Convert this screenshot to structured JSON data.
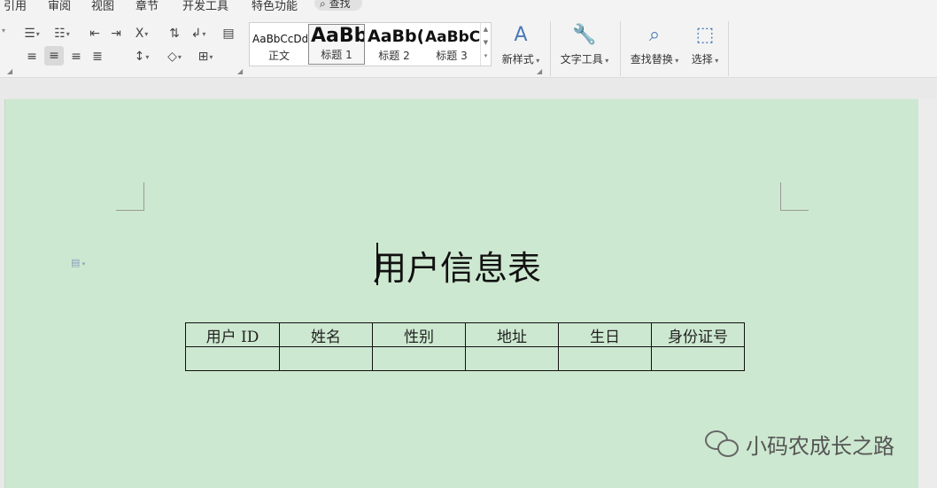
{
  "menu": {
    "tabs": [
      "引用",
      "审阅",
      "视图",
      "章节",
      "开发工具",
      "特色功能"
    ],
    "search_label": "查找"
  },
  "ribbon": {
    "styles": [
      {
        "sample": "AaBbCcDd",
        "name": "正文"
      },
      {
        "sample": "AaBb",
        "name": "标题 1"
      },
      {
        "sample": "AaBb(",
        "name": "标题 2"
      },
      {
        "sample": "AaBbC",
        "name": "标题 3"
      }
    ],
    "new_style_label": "新样式",
    "text_tools_label": "文字工具",
    "find_replace_label": "查找替换",
    "select_label": "选择"
  },
  "document": {
    "title": "用户信息表",
    "table": {
      "headers": [
        "用户 ID",
        "姓名",
        "性别",
        "地址",
        "生日",
        "身份证号"
      ],
      "rows": [
        [
          "",
          "",
          "",
          "",
          "",
          ""
        ]
      ]
    }
  },
  "watermark": {
    "text": "小码农成长之路"
  },
  "colors": {
    "page_background": "#cde8d0",
    "ribbon_background": "#f3f3f3",
    "accent_icon": "#4a78b8"
  }
}
